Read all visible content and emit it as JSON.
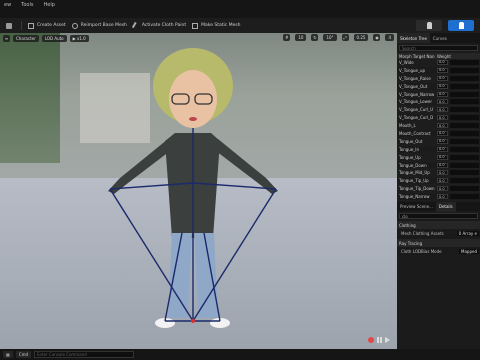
{
  "menubar": {
    "items": [
      "ew",
      "Tools",
      "Help"
    ]
  },
  "toolbar": {
    "create_asset": "Create Asset",
    "reimport": "Reimport Base Mesh",
    "activate_cloth": "Activate Cloth Paint",
    "make_static": "Make Static Mesh"
  },
  "viewport": {
    "chips": [
      "Character",
      "LOD Auto",
      "▶ x1.0"
    ],
    "right_chips": [
      "10",
      "10°",
      "0.25",
      "4"
    ]
  },
  "right_panel": {
    "tabs": [
      "Skeleton Tree",
      "Curves"
    ],
    "search_placeholder": "Search",
    "col_name": "Morph Target Nan",
    "col_weight": "Weight",
    "rows": [
      {
        "name": "V_Wide",
        "weight": "0.0"
      },
      {
        "name": "V_Tongue_up",
        "weight": "0.0"
      },
      {
        "name": "V_Tongue_Raise",
        "weight": "0.0"
      },
      {
        "name": "V_Tongue_Out",
        "weight": "0.0"
      },
      {
        "name": "V_Tongue_Narrow",
        "weight": "0.0"
      },
      {
        "name": "V_Tongue_Lower",
        "weight": "0.0"
      },
      {
        "name": "V_Tongue_Curl_U",
        "weight": "0.0"
      },
      {
        "name": "V_Tongue_Curl_D",
        "weight": "0.0"
      },
      {
        "name": "Mouth_L",
        "weight": "0.0"
      },
      {
        "name": "Mouth_Contract",
        "weight": "0.0"
      },
      {
        "name": "Tongue_Out",
        "weight": "0.0"
      },
      {
        "name": "Tongue_In",
        "weight": "0.0"
      },
      {
        "name": "Tongue_Up",
        "weight": "0.0"
      },
      {
        "name": "Tongue_Down",
        "weight": "0.0"
      },
      {
        "name": "Tongue_Mid_Up",
        "weight": "0.0"
      },
      {
        "name": "Tongue_Tip_Up",
        "weight": "0.0"
      },
      {
        "name": "Tongue_Tip_Down",
        "weight": "0.0"
      },
      {
        "name": "Tongue_Narrow",
        "weight": "0.0"
      }
    ],
    "subtabs": [
      "Preview Scene...",
      "Details"
    ],
    "details_search": "clo",
    "sections": [
      {
        "title": "Clothing",
        "prop": "Mesh Clothing Assets",
        "value": "0 Array e"
      },
      {
        "title": "Ray Tracing",
        "prop": "Cloth LODBias Mode",
        "value": "Mapped"
      }
    ]
  },
  "statusbar": {
    "cmd": "Cmd",
    "placeholder": "Enter Console Command"
  }
}
